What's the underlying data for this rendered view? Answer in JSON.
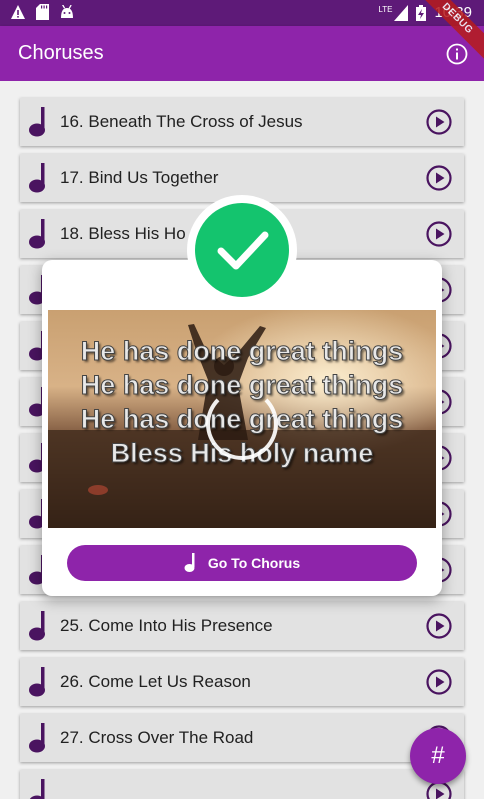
{
  "status_bar": {
    "time": "10:39",
    "network": "LTE",
    "icons": [
      "warning-icon",
      "sd-card-icon",
      "android-icon",
      "signal-icon",
      "battery-charging-icon"
    ],
    "debug_label": "DEBUG"
  },
  "app_bar": {
    "title": "Choruses",
    "info_icon": "info-icon"
  },
  "list": {
    "items": [
      {
        "label": "16. Beneath The Cross of Jesus"
      },
      {
        "label": "17. Bind Us Together"
      },
      {
        "label": "18. Bless His Ho"
      },
      {
        "label": ""
      },
      {
        "label": ""
      },
      {
        "label": ""
      },
      {
        "label": ""
      },
      {
        "label": ""
      },
      {
        "label": ""
      },
      {
        "label": "25. Come Into His Presence"
      },
      {
        "label": "26. Come Let Us Reason"
      },
      {
        "label": "27. Cross Over The Road"
      },
      {
        "label": ""
      }
    ]
  },
  "dialog": {
    "status_icon": "check-circle-icon",
    "lyrics": [
      "He has done great things",
      "He has done great things",
      "He has done great things",
      "Bless His holy name"
    ],
    "button_label": "Go To Chorus",
    "button_icon": "music-note-icon"
  },
  "fab": {
    "label": "#"
  },
  "colors": {
    "primary": "#8e24aa",
    "primary_dark": "#5e1a78",
    "success": "#14c46e",
    "list_bg": "#e2e2e2",
    "icon": "#4a1460"
  }
}
